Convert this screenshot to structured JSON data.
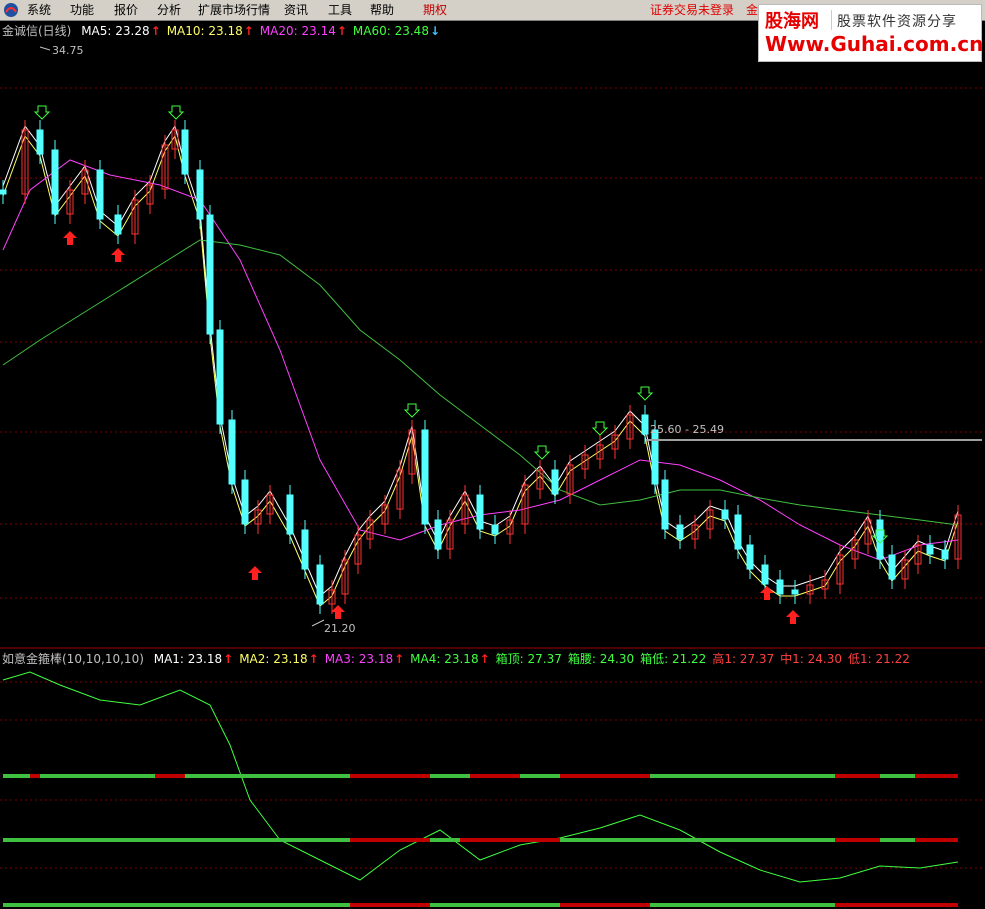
{
  "menu": {
    "items": [
      "系统",
      "功能",
      "报价",
      "分析",
      "扩展市场行情",
      "资讯",
      "工具",
      "帮助",
      "期权"
    ],
    "login_status": "证券交易未登录",
    "login_extra": "金"
  },
  "banner": {
    "brand": "股海网",
    "tagline": "股票软件资源分享",
    "url": "Www.Guhai.com.cn"
  },
  "main_chart": {
    "title": "金诚信(日线)",
    "indicators": [
      {
        "label": "MA5: 23.28",
        "arrow": "↑",
        "color": "#ffffff",
        "arrow_color": "#ff2020"
      },
      {
        "label": "MA10: 23.18",
        "arrow": "↑",
        "color": "#ffff66",
        "arrow_color": "#ff2020"
      },
      {
        "label": "MA20: 23.14",
        "arrow": "↑",
        "color": "#ff40ff",
        "arrow_color": "#ff2020"
      },
      {
        "label": "MA60: 23.48",
        "arrow": "↓",
        "color": "#40ff40",
        "arrow_color": "#40c0ff"
      }
    ],
    "annotations": {
      "high": "34.75",
      "low": "21.20",
      "range": "25.60 - 25.49"
    },
    "colors": {
      "up": "#ff3232",
      "down": "#54ffff",
      "grid": "#800000",
      "ma5": "#ffffff",
      "ma10": "#ffff66",
      "ma20": "#ff40ff",
      "ma60": "#40c040"
    }
  },
  "sub_chart": {
    "title": "如意金箍棒(10,10,10,10)",
    "indicators": [
      {
        "label": "MA1: 23.18",
        "arrow": "↑",
        "color": "#ffffff",
        "arrow_color": "#ff2020"
      },
      {
        "label": "MA2: 23.18",
        "arrow": "↑",
        "color": "#ffff66",
        "arrow_color": "#ff2020"
      },
      {
        "label": "MA3: 23.18",
        "arrow": "↑",
        "color": "#ff40ff",
        "arrow_color": "#ff2020"
      },
      {
        "label": "MA4: 23.18",
        "arrow": "↑",
        "color": "#40ff40",
        "arrow_color": "#ff2020"
      },
      {
        "label": "箱顶: 27.37",
        "arrow": "",
        "color": "#40ff40",
        "arrow_color": ""
      },
      {
        "label": "箱腰: 24.30",
        "arrow": "",
        "color": "#40ff40",
        "arrow_color": ""
      },
      {
        "label": "箱低: 21.22",
        "arrow": "",
        "color": "#40ff40",
        "arrow_color": ""
      },
      {
        "label": "高1: 27.37",
        "arrow": "",
        "color": "#ff4040",
        "arrow_color": ""
      },
      {
        "label": "中1: 24.30",
        "arrow": "",
        "color": "#ff4040",
        "arrow_color": ""
      },
      {
        "label": "低1: 21.22",
        "arrow": "",
        "color": "#ff4040",
        "arrow_color": ""
      }
    ]
  }
}
